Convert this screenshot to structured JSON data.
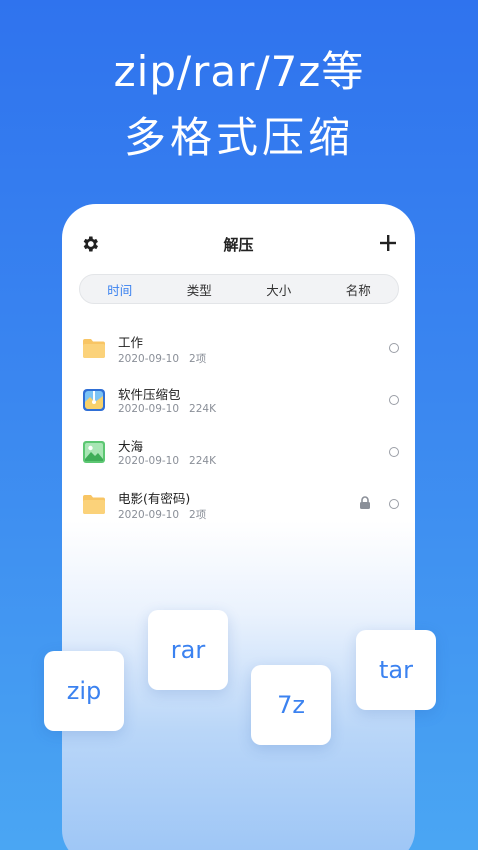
{
  "headline": {
    "line1": "zip/rar/7z等",
    "line2": "多格式压缩"
  },
  "app": {
    "title": "解压",
    "settings_icon": "gear-icon",
    "add_icon": "plus-icon"
  },
  "sort_tabs": [
    {
      "label": "时间",
      "active": true
    },
    {
      "label": "类型",
      "active": false
    },
    {
      "label": "大小",
      "active": false
    },
    {
      "label": "名称",
      "active": false
    }
  ],
  "files": [
    {
      "name": "工作",
      "date": "2020-09-10",
      "info": "2项",
      "icon": "folder-icon",
      "locked": false
    },
    {
      "name": "软件压缩包",
      "date": "2020-09-10",
      "info": "224K",
      "icon": "archive-icon",
      "locked": false
    },
    {
      "name": "大海",
      "date": "2020-09-10",
      "info": "224K",
      "icon": "image-icon",
      "locked": false
    },
    {
      "name": "电影(有密码)",
      "date": "2020-09-10",
      "info": "2项",
      "icon": "folder-icon",
      "locked": true
    }
  ],
  "formats": [
    "zip",
    "rar",
    "7z",
    "tar"
  ],
  "colors": {
    "accent": "#3b82f0",
    "folder": "#f8c564",
    "background_top": "#2f73ee",
    "background_bottom": "#4aa6f3"
  }
}
